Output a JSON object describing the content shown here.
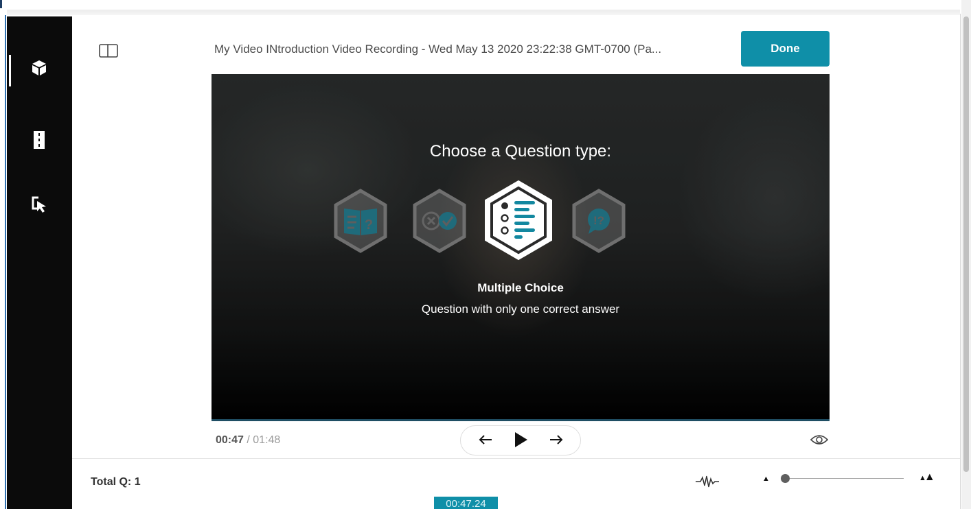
{
  "header": {
    "video_title": "My Video INtroduction Video Recording - Wed May 13 2020 23:22:38 GMT-0700 (Pa...",
    "done_label": "Done"
  },
  "sidebar": {
    "items": [
      {
        "name": "quiz",
        "icon": "cube-icon",
        "active": true
      },
      {
        "name": "chapters",
        "icon": "film-strip-icon",
        "active": false
      },
      {
        "name": "hotspots",
        "icon": "cursor-click-icon",
        "active": false
      }
    ]
  },
  "overlay": {
    "title": "Choose a Question type:",
    "question_types": [
      {
        "icon": "open-book-question-icon",
        "selected": false
      },
      {
        "icon": "true-false-icon",
        "selected": false
      },
      {
        "icon": "multiple-choice-list-icon",
        "selected": true
      },
      {
        "icon": "speech-bubble-exclamation-question-icon",
        "selected": false
      }
    ],
    "selected_name": "Multiple Choice",
    "selected_description": "Question with only one correct answer"
  },
  "playback": {
    "current_time": "00:47",
    "separator": " / ",
    "duration": "01:48"
  },
  "footer": {
    "total_questions": "Total Q: 1",
    "marker_time": "00:47.24"
  },
  "colors": {
    "accent": "#0f8fa8",
    "rail_background": "#0b0b0b"
  }
}
